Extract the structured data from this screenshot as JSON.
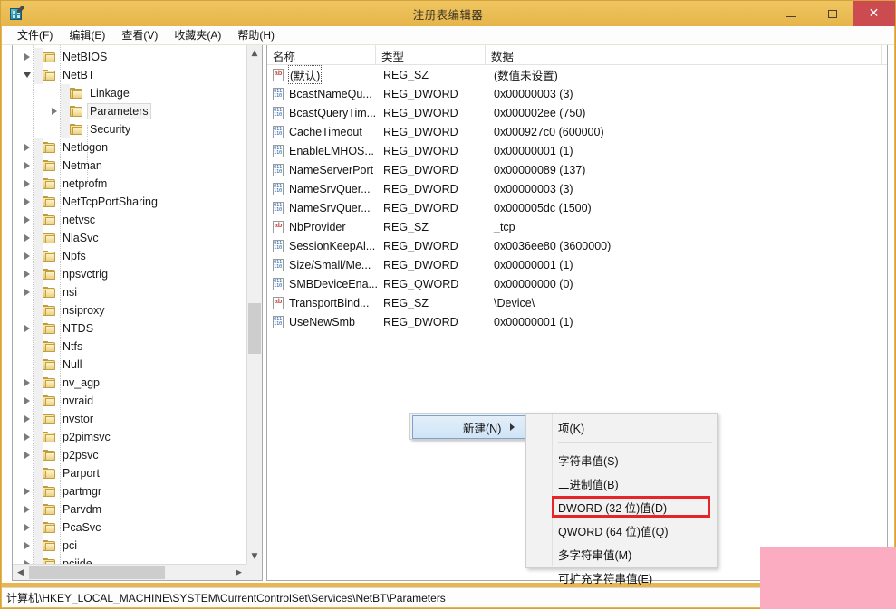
{
  "window": {
    "title": "注册表编辑器",
    "icon": "registry-editor-icon",
    "controls": {
      "minimize": "–",
      "maximize": "□",
      "close": "✕"
    }
  },
  "menubar": {
    "items": [
      {
        "label": "文件(F)",
        "name": "menu-file"
      },
      {
        "label": "编辑(E)",
        "name": "menu-edit"
      },
      {
        "label": "查看(V)",
        "name": "menu-view"
      },
      {
        "label": "收藏夹(A)",
        "name": "menu-favorites"
      },
      {
        "label": "帮助(H)",
        "name": "menu-help"
      }
    ]
  },
  "tree": {
    "nodes": [
      {
        "label": "NetBIOS",
        "indent": 1,
        "twist": "closed",
        "selected": false
      },
      {
        "label": "NetBT",
        "indent": 1,
        "twist": "open",
        "selected": false
      },
      {
        "label": "Linkage",
        "indent": 2,
        "twist": "none",
        "selected": false
      },
      {
        "label": "Parameters",
        "indent": 2,
        "twist": "closed",
        "selected": true
      },
      {
        "label": "Security",
        "indent": 2,
        "twist": "none",
        "selected": false
      },
      {
        "label": "Netlogon",
        "indent": 1,
        "twist": "closed",
        "selected": false
      },
      {
        "label": "Netman",
        "indent": 1,
        "twist": "closed",
        "selected": false
      },
      {
        "label": "netprofm",
        "indent": 1,
        "twist": "closed",
        "selected": false
      },
      {
        "label": "NetTcpPortSharing",
        "indent": 1,
        "twist": "closed",
        "selected": false
      },
      {
        "label": "netvsc",
        "indent": 1,
        "twist": "closed",
        "selected": false
      },
      {
        "label": "NlaSvc",
        "indent": 1,
        "twist": "closed",
        "selected": false
      },
      {
        "label": "Npfs",
        "indent": 1,
        "twist": "closed",
        "selected": false
      },
      {
        "label": "npsvctrig",
        "indent": 1,
        "twist": "closed",
        "selected": false
      },
      {
        "label": "nsi",
        "indent": 1,
        "twist": "closed",
        "selected": false
      },
      {
        "label": "nsiproxy",
        "indent": 1,
        "twist": "none",
        "selected": false
      },
      {
        "label": "NTDS",
        "indent": 1,
        "twist": "closed",
        "selected": false
      },
      {
        "label": "Ntfs",
        "indent": 1,
        "twist": "none",
        "selected": false
      },
      {
        "label": "Null",
        "indent": 1,
        "twist": "none",
        "selected": false
      },
      {
        "label": "nv_agp",
        "indent": 1,
        "twist": "closed",
        "selected": false
      },
      {
        "label": "nvraid",
        "indent": 1,
        "twist": "closed",
        "selected": false
      },
      {
        "label": "nvstor",
        "indent": 1,
        "twist": "closed",
        "selected": false
      },
      {
        "label": "p2pimsvc",
        "indent": 1,
        "twist": "closed",
        "selected": false
      },
      {
        "label": "p2psvc",
        "indent": 1,
        "twist": "closed",
        "selected": false
      },
      {
        "label": "Parport",
        "indent": 1,
        "twist": "none",
        "selected": false
      },
      {
        "label": "partmgr",
        "indent": 1,
        "twist": "closed",
        "selected": false
      },
      {
        "label": "Parvdm",
        "indent": 1,
        "twist": "closed",
        "selected": false
      },
      {
        "label": "PcaSvc",
        "indent": 1,
        "twist": "closed",
        "selected": false
      },
      {
        "label": "pci",
        "indent": 1,
        "twist": "closed",
        "selected": false
      },
      {
        "label": "pciide",
        "indent": 1,
        "twist": "closed",
        "selected": false
      }
    ]
  },
  "values": {
    "columns": [
      {
        "label": "名称",
        "name": "column-name"
      },
      {
        "label": "类型",
        "name": "column-type"
      },
      {
        "label": "数据",
        "name": "column-data"
      }
    ],
    "rows": [
      {
        "name": "(默认)",
        "icon": "string-value-icon",
        "type": "REG_SZ",
        "data": "(数值未设置)",
        "focused": true
      },
      {
        "name": "BcastNameQu...",
        "icon": "binary-value-icon",
        "type": "REG_DWORD",
        "data": "0x00000003 (3)",
        "focused": false
      },
      {
        "name": "BcastQueryTim...",
        "icon": "binary-value-icon",
        "type": "REG_DWORD",
        "data": "0x000002ee (750)",
        "focused": false
      },
      {
        "name": "CacheTimeout",
        "icon": "binary-value-icon",
        "type": "REG_DWORD",
        "data": "0x000927c0 (600000)",
        "focused": false
      },
      {
        "name": "EnableLMHOS...",
        "icon": "binary-value-icon",
        "type": "REG_DWORD",
        "data": "0x00000001 (1)",
        "focused": false
      },
      {
        "name": "NameServerPort",
        "icon": "binary-value-icon",
        "type": "REG_DWORD",
        "data": "0x00000089 (137)",
        "focused": false
      },
      {
        "name": "NameSrvQuer...",
        "icon": "binary-value-icon",
        "type": "REG_DWORD",
        "data": "0x00000003 (3)",
        "focused": false
      },
      {
        "name": "NameSrvQuer...",
        "icon": "binary-value-icon",
        "type": "REG_DWORD",
        "data": "0x000005dc (1500)",
        "focused": false
      },
      {
        "name": "NbProvider",
        "icon": "string-value-icon",
        "type": "REG_SZ",
        "data": "_tcp",
        "focused": false
      },
      {
        "name": "SessionKeepAl...",
        "icon": "binary-value-icon",
        "type": "REG_DWORD",
        "data": "0x0036ee80 (3600000)",
        "focused": false
      },
      {
        "name": "Size/Small/Me...",
        "icon": "binary-value-icon",
        "type": "REG_DWORD",
        "data": "0x00000001 (1)",
        "focused": false
      },
      {
        "name": "SMBDeviceEna...",
        "icon": "binary-value-icon",
        "type": "REG_QWORD",
        "data": "0x00000000 (0)",
        "focused": false
      },
      {
        "name": "TransportBind...",
        "icon": "string-value-icon",
        "type": "REG_SZ",
        "data": "\\Device\\",
        "focused": false
      },
      {
        "name": "UseNewSmb",
        "icon": "binary-value-icon",
        "type": "REG_DWORD",
        "data": "0x00000001 (1)",
        "focused": false
      }
    ]
  },
  "context_menu": {
    "parent_label": "新建(N)",
    "submenu_items": [
      {
        "label": "项(K)",
        "name": "ctx-new-key",
        "marked": false,
        "separator_after": true
      },
      {
        "label": "字符串值(S)",
        "name": "ctx-new-string",
        "marked": false,
        "separator_after": false
      },
      {
        "label": "二进制值(B)",
        "name": "ctx-new-binary",
        "marked": false,
        "separator_after": false
      },
      {
        "label": "DWORD (32 位)值(D)",
        "name": "ctx-new-dword",
        "marked": true,
        "separator_after": false
      },
      {
        "label": "QWORD (64 位)值(Q)",
        "name": "ctx-new-qword",
        "marked": false,
        "separator_after": false
      },
      {
        "label": "多字符串值(M)",
        "name": "ctx-new-multi-string",
        "marked": false,
        "separator_after": false
      },
      {
        "label": "可扩充字符串值(E)",
        "name": "ctx-new-expand-string",
        "marked": false,
        "separator_after": false
      }
    ]
  },
  "statusbar": {
    "path": "计算机\\HKEY_LOCAL_MACHINE\\SYSTEM\\CurrentControlSet\\Services\\NetBT\\Parameters"
  },
  "colors": {
    "titlebar": "#eabd55",
    "close_button": "#cc4b50",
    "annotation_red": "#e8232a",
    "overlay_pink": "#fcacc0",
    "selection_blue": "#cfe4f7"
  }
}
